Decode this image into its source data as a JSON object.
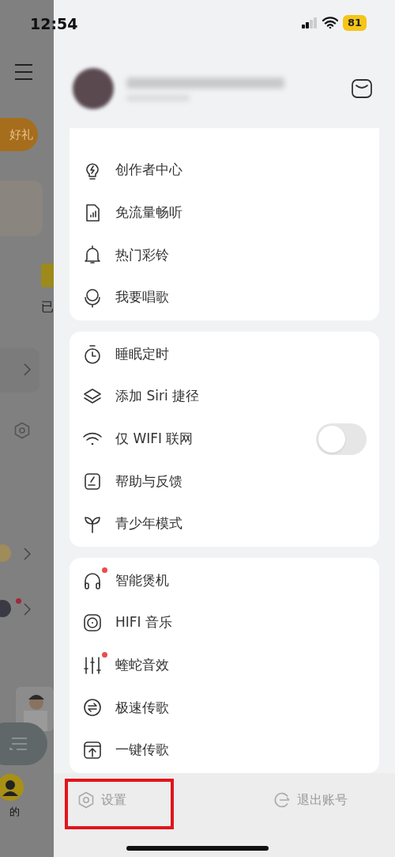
{
  "status_bar": {
    "time": "12:54",
    "battery": "81"
  },
  "background": {
    "gift_button": "好礼",
    "tab_2": "已",
    "nav_label": "的"
  },
  "menu_groups": [
    {
      "items": [
        {
          "label": "创作者中心",
          "kind": "link",
          "badge": false
        },
        {
          "label": "免流量畅听",
          "kind": "link",
          "badge": false
        },
        {
          "label": "热门彩铃",
          "kind": "link",
          "badge": false
        },
        {
          "label": "我要唱歌",
          "kind": "link",
          "badge": false
        }
      ]
    },
    {
      "items": [
        {
          "label": "睡眠定时",
          "kind": "link",
          "badge": false
        },
        {
          "label": "添加 Siri 捷径",
          "kind": "link",
          "badge": false
        },
        {
          "label": "仅 WIFI 联网",
          "kind": "switch",
          "on": false,
          "badge": false
        },
        {
          "label": "帮助与反馈",
          "kind": "link",
          "badge": false
        },
        {
          "label": "青少年模式",
          "kind": "link",
          "badge": false
        }
      ]
    },
    {
      "items": [
        {
          "label": "智能煲机",
          "kind": "link",
          "badge": true
        },
        {
          "label": "HIFI 音乐",
          "kind": "link",
          "badge": false
        },
        {
          "label": "蝰蛇音效",
          "kind": "link",
          "badge": true
        },
        {
          "label": "极速传歌",
          "kind": "link",
          "badge": false
        },
        {
          "label": "一键传歌",
          "kind": "link",
          "badge": false
        }
      ]
    }
  ],
  "footer": {
    "settings": "设置",
    "logout": "退出账号",
    "settings_highlighted": true
  }
}
